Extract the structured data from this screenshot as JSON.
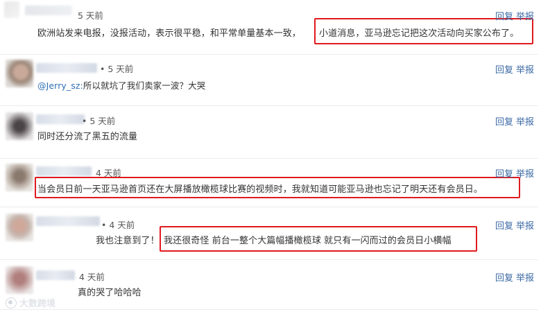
{
  "comments": [
    {
      "time": "5 天前",
      "text": "欧洲站发来电报，没报活动，表示很平稳，和平常单量基本一致，",
      "highlight": "小道消息，亚马逊忘记把这次活动向买家公布了。",
      "reply": "回复",
      "report": "举报"
    },
    {
      "time": "• 5 天前",
      "mention": "@Jerry_sz:",
      "text": "所以就坑了我们卖家一波？大哭",
      "reply": "回复",
      "report": "举报"
    },
    {
      "time": "• 5 天前",
      "text": "同时还分流了黑五的流量",
      "reply": "回复",
      "report": "举报"
    },
    {
      "time": "4 天前",
      "highlight": "当会员日前一天亚马逊首页还在大屏播放橄榄球比赛的视频时，我就知道可能亚马逊也忘记了明天还有会员日。",
      "reply": "回复",
      "report": "举报"
    },
    {
      "time": "• 4 天前",
      "text": "我也注意到了！",
      "highlight": "我还很奇怪 前台一整个大篇幅播橄榄球 就只有一闪而过的会员日小横幅",
      "reply": "回复",
      "report": "举报"
    },
    {
      "time": "4 天前",
      "text": "真的哭了哈哈哈",
      "reply": "回复",
      "report": "举报"
    }
  ],
  "watermark": "大数跨境",
  "colors": {
    "highlight_border": "#e0191e",
    "action_link": "#3b6aa5",
    "mention": "#2f6fb6"
  }
}
